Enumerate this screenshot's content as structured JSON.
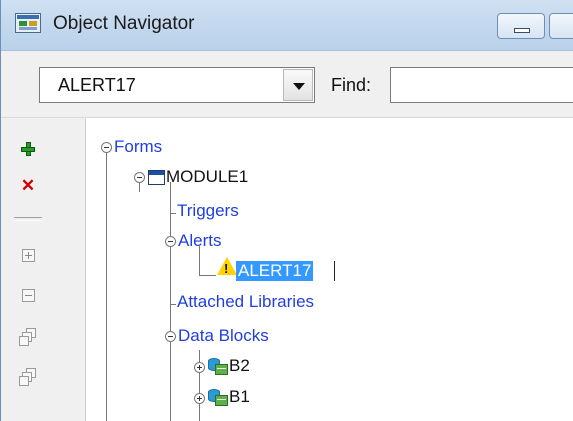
{
  "window": {
    "title": "Object Navigator"
  },
  "toolbar": {
    "object_combo_value": "ALERT17",
    "find_label": "Find:",
    "find_value": ""
  },
  "sidebar": {
    "buttons": [
      {
        "name": "create",
        "icon": "plus-icon",
        "color": "#2b9a2b"
      },
      {
        "name": "delete",
        "icon": "delete-x-icon",
        "color": "#d00000"
      },
      {
        "name": "expand",
        "icon": "expand-icon"
      },
      {
        "name": "collapse",
        "icon": "collapse-icon"
      },
      {
        "name": "expand-all",
        "icon": "expand-all-icon"
      },
      {
        "name": "collapse-all",
        "icon": "collapse-all-icon"
      }
    ]
  },
  "tree": {
    "nodes": [
      {
        "label": "Forms",
        "level": 0,
        "state": "expanded"
      },
      {
        "label": "MODULE1",
        "level": 1,
        "state": "expanded",
        "icon": "form-module-icon"
      },
      {
        "label": "Triggers",
        "level": 2
      },
      {
        "label": "Alerts",
        "level": 2,
        "state": "expanded"
      },
      {
        "label": "ALERT17",
        "level": 3,
        "selected": true,
        "icon": "alert-warning-icon"
      },
      {
        "label": "Attached Libraries",
        "level": 2
      },
      {
        "label": "Data Blocks",
        "level": 2,
        "state": "expanded"
      },
      {
        "label": "B2",
        "level": 3,
        "state": "collapsed",
        "icon": "data-block-icon"
      },
      {
        "label": "B1",
        "level": 3,
        "state": "collapsed",
        "icon": "data-block-icon"
      }
    ]
  },
  "colors": {
    "node_text": "#1f3fe0",
    "selection": "#3399ff",
    "titlebar": "#c3d8ee"
  }
}
